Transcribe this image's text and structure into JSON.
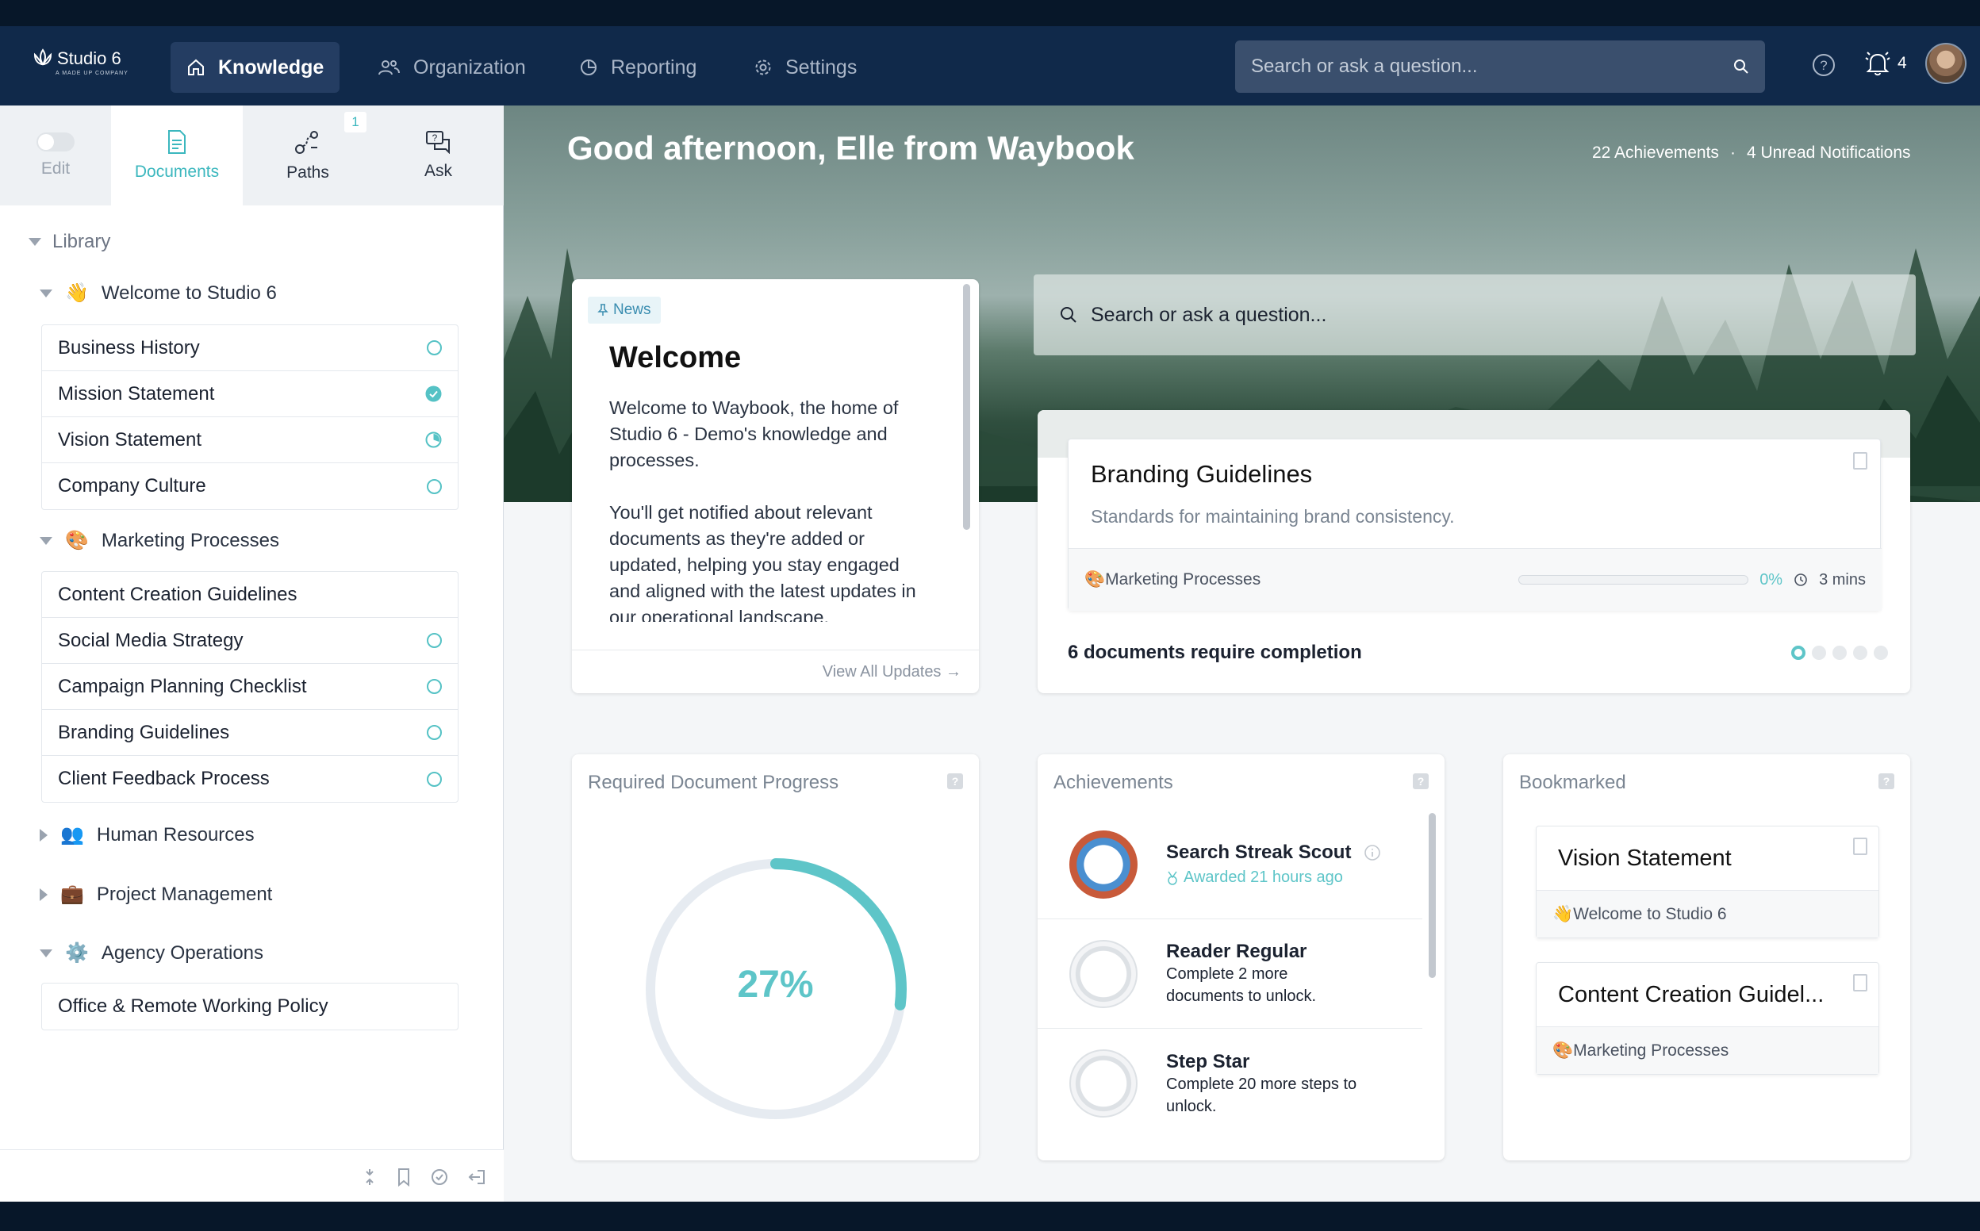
{
  "app": {
    "logo_text": "Studio 6",
    "logo_sub": "A MADE UP COMPANY"
  },
  "nav": {
    "tabs": [
      {
        "label": "Knowledge",
        "icon": "home-icon"
      },
      {
        "label": "Organization",
        "icon": "people-icon"
      },
      {
        "label": "Reporting",
        "icon": "chart-icon"
      },
      {
        "label": "Settings",
        "icon": "gear-icon"
      }
    ],
    "search_placeholder": "Search or ask a question...",
    "notification_count": "4"
  },
  "sidebar": {
    "edit_label": "Edit",
    "tabs": [
      {
        "label": "Documents"
      },
      {
        "label": "Paths",
        "badge": "1"
      },
      {
        "label": "Ask"
      }
    ],
    "library_label": "Library",
    "groups": [
      {
        "emoji": "👋",
        "label": "Welcome to Studio 6",
        "expanded": true,
        "items": [
          {
            "label": "Business History",
            "status": "todo"
          },
          {
            "label": "Mission Statement",
            "status": "done"
          },
          {
            "label": "Vision Statement",
            "status": "partial"
          },
          {
            "label": "Company Culture",
            "status": "todo"
          }
        ]
      },
      {
        "emoji": "🎨",
        "label": "Marketing Processes",
        "expanded": true,
        "items": [
          {
            "label": "Content Creation Guidelines",
            "status": "none"
          },
          {
            "label": "Social Media Strategy",
            "status": "todo"
          },
          {
            "label": "Campaign Planning Checklist",
            "status": "todo"
          },
          {
            "label": "Branding Guidelines",
            "status": "todo"
          },
          {
            "label": "Client Feedback Process",
            "status": "todo"
          }
        ]
      },
      {
        "emoji": "👥",
        "label": "Human Resources",
        "expanded": false
      },
      {
        "emoji": "💼",
        "label": "Project Management",
        "expanded": false
      },
      {
        "emoji": "⚙️",
        "label": "Agency Operations",
        "expanded": true,
        "items": [
          {
            "label": "Office & Remote Working Policy",
            "status": "none"
          }
        ]
      }
    ]
  },
  "main": {
    "greeting": "Good afternoon, Elle from Waybook",
    "achievements_count": "22 Achievements",
    "separator": "·",
    "unread": "4 Unread Notifications",
    "search_placeholder": "Search or ask a question...",
    "welcome": {
      "badge": "News",
      "title": "Welcome",
      "p1": "Welcome to Waybook, the home of Studio 6 - Demo's knowledge and processes.",
      "p2": "You'll get notified about relevant documents as they're added or updated, helping you stay engaged and aligned with the latest updates in our operational landscape.",
      "link": "View All Updates →"
    },
    "required": {
      "doc_title": "Branding Guidelines",
      "doc_desc": "Standards for maintaining brand consistency.",
      "doc_group": "🎨Marketing Processes",
      "doc_percent": "0%",
      "doc_progress": 0,
      "doc_time": "3 mins",
      "summary": "6 documents require completion",
      "pages": 5,
      "current_page": 1
    },
    "progress_card": {
      "title": "Required Document Progress",
      "value": "27%",
      "fraction": 0.27
    },
    "achievements": {
      "title": "Achievements",
      "items": [
        {
          "name": "Search Streak Scout",
          "sub": "Awarded 21 hours ago",
          "earned": true
        },
        {
          "name": "Reader Regular",
          "sub": "Complete 2 more documents to unlock.",
          "earned": false
        },
        {
          "name": "Step Star",
          "sub": "Complete 20 more steps to unlock.",
          "earned": false
        }
      ]
    },
    "bookmarked": {
      "title": "Bookmarked",
      "items": [
        {
          "title": "Vision Statement",
          "group": "👋Welcome to Studio 6"
        },
        {
          "title": "Content Creation Guidel...",
          "group": "🎨Marketing Processes"
        }
      ]
    }
  },
  "colors": {
    "accent": "#5ec5c8",
    "nav_bg": "#10294a"
  }
}
